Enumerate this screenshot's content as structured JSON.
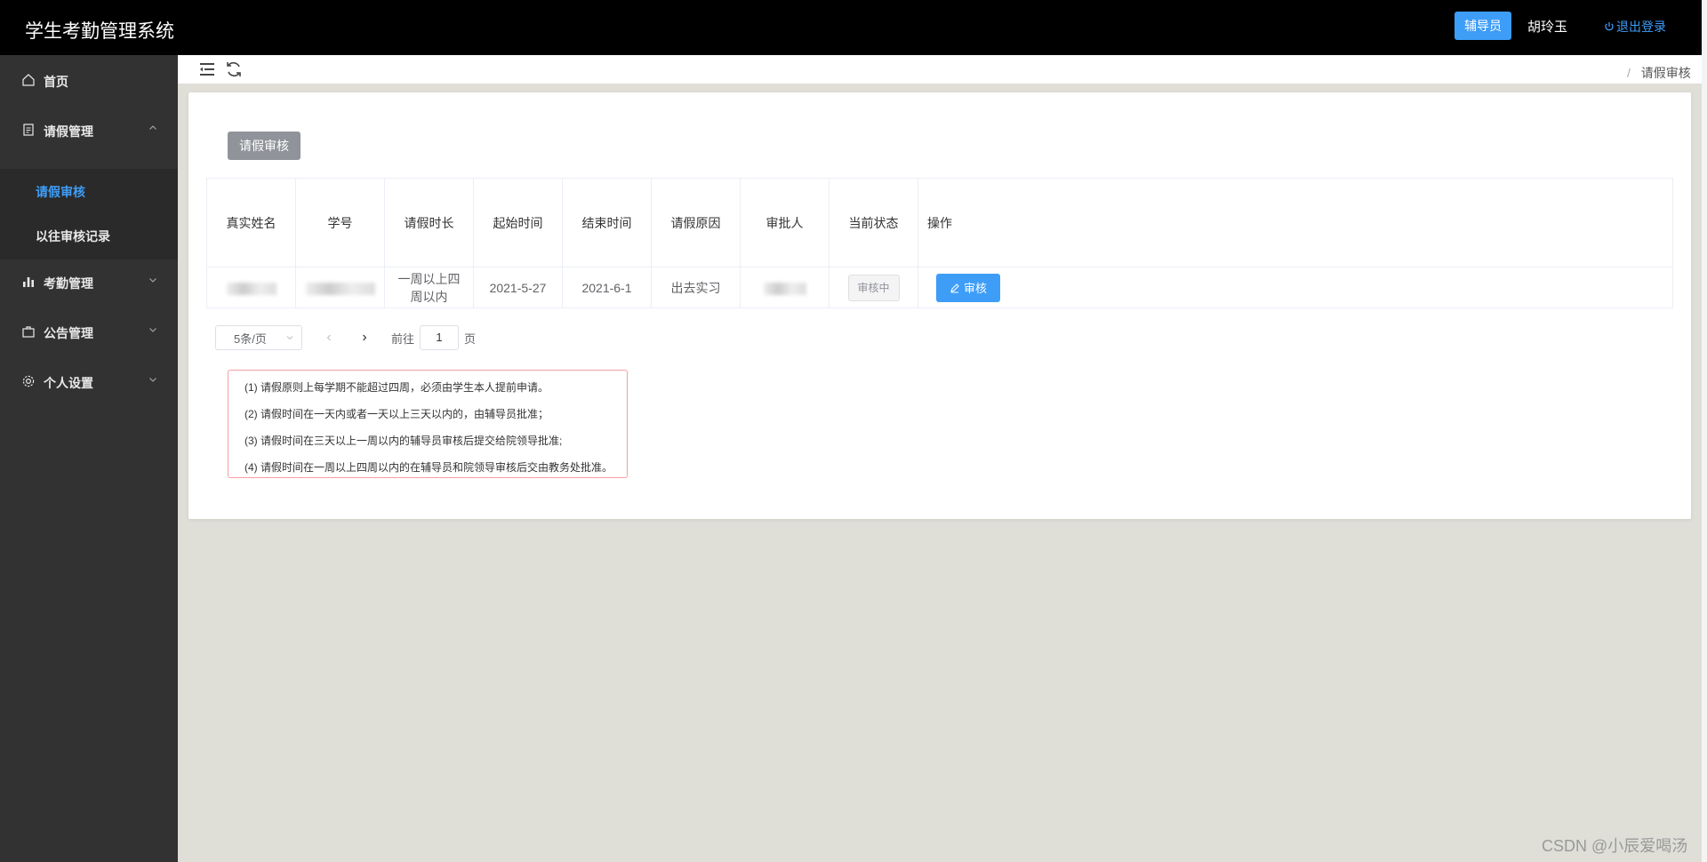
{
  "header": {
    "title": "学生考勤管理系统",
    "role": "辅导员",
    "username": "胡玲玉",
    "logout": "退出登录"
  },
  "sidebar": {
    "items": [
      {
        "label": "首页",
        "icon": "home-icon"
      },
      {
        "label": "请假管理",
        "icon": "document-icon",
        "expanded": true
      },
      {
        "label": "考勤管理",
        "icon": "bar-chart-icon"
      },
      {
        "label": "公告管理",
        "icon": "briefcase-icon"
      },
      {
        "label": "个人设置",
        "icon": "gear-icon"
      }
    ],
    "subitems": [
      {
        "label": "请假审核",
        "active": true
      },
      {
        "label": "以往审核记录",
        "active": false
      }
    ]
  },
  "breadcrumb": {
    "separator": "/",
    "current": "请假审核"
  },
  "panel": {
    "tag": "请假审核",
    "table": {
      "headers": [
        "真实姓名",
        "学号",
        "请假时长",
        "起始时间",
        "结束时间",
        "请假原因",
        "审批人",
        "当前状态",
        "操作"
      ],
      "rows": [
        {
          "duration": "一周以上四周以内",
          "start": "2021-5-27",
          "end": "2021-6-1",
          "reason": "出去实习",
          "status": "审核中",
          "action": "审核"
        }
      ]
    },
    "pager": {
      "page_size": "5条/页",
      "goto_label": "前往",
      "page": "1",
      "page_unit": "页"
    },
    "rules": [
      "(1) 请假原则上每学期不能超过四周，必须由学生本人提前申请。",
      "(2) 请假时间在一天内或者一天以上三天以内的，由辅导员批准；",
      "(3) 请假时间在三天以上一周以内的辅导员审核后提交给院领导批准;",
      "(4) 请假时间在一周以上四周以内的在辅导员和院领导审核后交由教务处批准。"
    ]
  },
  "watermark": "CSDN @小辰爱喝汤",
  "colors": {
    "accent": "#3e9df7",
    "header_bg": "#000000",
    "sidebar_bg": "#323232",
    "tag_gray": "#909399"
  }
}
